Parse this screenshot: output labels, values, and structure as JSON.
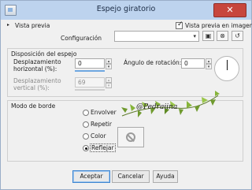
{
  "window": {
    "title": "Espejo giratorio",
    "close_glyph": "✕"
  },
  "top": {
    "vista_previa": "Vista previa",
    "vista_previa_imagen": "Vista previa en imagen",
    "configuracion": "Configuración",
    "preset_value": "",
    "preset_checked": true
  },
  "espejo": {
    "group_title": "Disposición del espejo",
    "desp_h_label": "Desplazamiento horizontal (%):",
    "desp_h_value": "0",
    "desp_v_label": "Desplazamiento vertical (%):",
    "desp_v_value": "69",
    "angulo_label": "Ángulo de rotación:",
    "angulo_value": "0"
  },
  "borde": {
    "group_title": "Modo de borde",
    "options": [
      "Envolver",
      "Repetir",
      "Color",
      "Reflejar"
    ],
    "selected": "Reflejar"
  },
  "watermark": {
    "text": "@Pedraiina"
  },
  "buttons": {
    "aceptar": "Aceptar",
    "cancelar": "Cancelar",
    "ayuda": "Ayuda"
  },
  "icons": {
    "expand": "▸",
    "dropdown": "▾",
    "spin_up": "▴",
    "spin_down": "▾",
    "check": "✓",
    "save": "▣",
    "delete": "⊗",
    "reset": "↺",
    "no_color": "⃠"
  },
  "colors": {
    "titlebar": "#bdd3ee",
    "close": "#c7463d",
    "accent": "#3f86d1"
  }
}
